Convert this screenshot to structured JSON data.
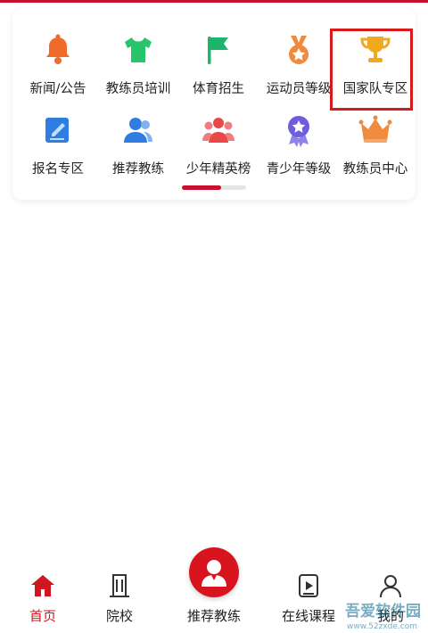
{
  "grid": {
    "row1": [
      {
        "label": "新闻/公告",
        "icon": "bell-icon",
        "color": "#f06a2a"
      },
      {
        "label": "教练员培训",
        "icon": "tshirt-icon",
        "color": "#27c46b"
      },
      {
        "label": "体育招生",
        "icon": "flag-icon",
        "color": "#1fb46b"
      },
      {
        "label": "运动员等级",
        "icon": "medal-icon",
        "color": "#f08a3c"
      },
      {
        "label": "国家队专区",
        "icon": "trophy-icon",
        "color": "#f2a81d"
      }
    ],
    "row2": [
      {
        "label": "报名专区",
        "icon": "edit-icon",
        "color": "#2f7de1"
      },
      {
        "label": "推荐教练",
        "icon": "users-icon",
        "color": "#2f7de1"
      },
      {
        "label": "少年精英榜",
        "icon": "group-icon",
        "color": "#e84848"
      },
      {
        "label": "青少年等级",
        "icon": "star-badge-icon",
        "color": "#6f5de0"
      },
      {
        "label": "教练员中心",
        "icon": "crown-icon",
        "color": "#f08a3c"
      }
    ]
  },
  "tabs": [
    {
      "label": "首页",
      "icon": "home-icon"
    },
    {
      "label": "院校",
      "icon": "building-icon"
    },
    {
      "label": "推荐教练",
      "icon": "coach-avatar-icon"
    },
    {
      "label": "在线课程",
      "icon": "video-icon"
    },
    {
      "label": "我的",
      "icon": "profile-icon"
    }
  ],
  "watermark": {
    "text": "吾爱软件园",
    "sub": "www.52zxde.com"
  },
  "colors": {
    "accent": "#d0161f",
    "highlight": "#d91a1a"
  }
}
